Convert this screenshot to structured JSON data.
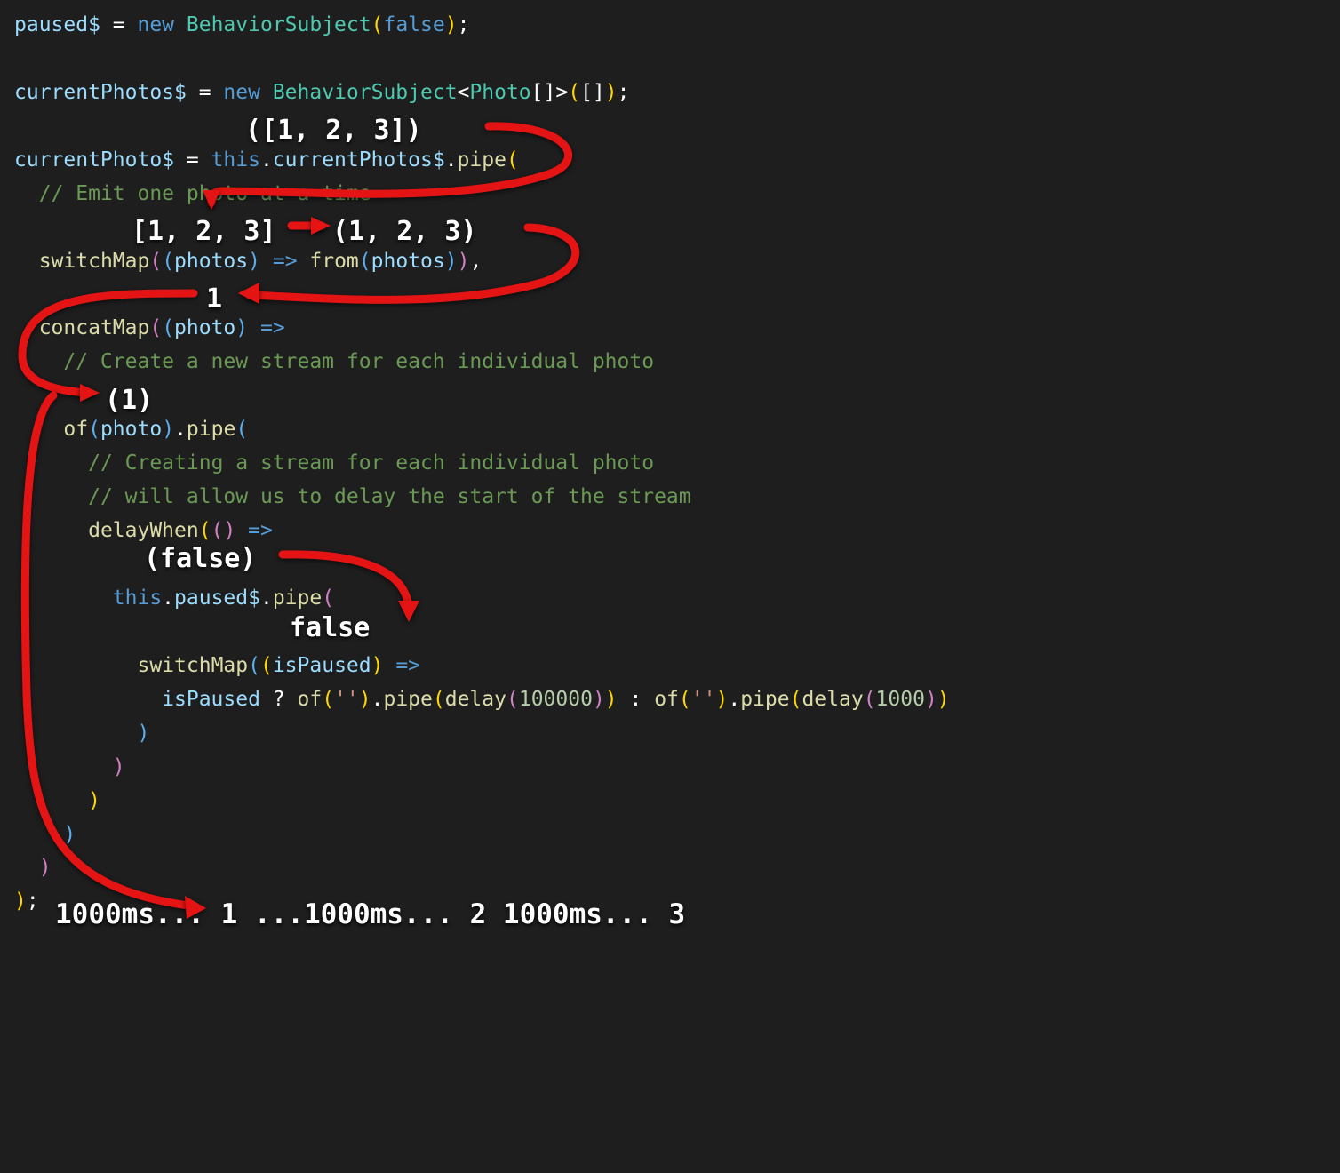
{
  "code": {
    "l1": {
      "var": "paused$",
      "eq": " = ",
      "new": "new",
      "sp": " ",
      "class": "BehaviorSubject",
      "lp": "(",
      "val": "false",
      "rp": ")",
      "semi": ";"
    },
    "l2": {
      "var": "currentPhotos$",
      "eq": " = ",
      "new": "new",
      "sp": " ",
      "class": "BehaviorSubject",
      "lt": "<",
      "type": "Photo",
      "arr": "[]",
      "gt": ">",
      "lp": "(",
      "val": "[]",
      "rp": ")",
      "semi": ";"
    },
    "l3": {
      "var": "currentPhoto$",
      "eq": " = ",
      "this": "this",
      "dot1": ".",
      "prop": "currentPhotos$",
      "dot2": ".",
      "func": "pipe",
      "lp": "("
    },
    "l4": {
      "comment": "// Emit one photo at a time"
    },
    "l5": {
      "func": "switchMap",
      "lp1": "(",
      "lp2": "(",
      "param": "photos",
      "rp2": ")",
      "arrow": " => ",
      "func2": "from",
      "lp3": "(",
      "arg": "photos",
      "rp3": ")",
      "rp1": ")",
      "comma": ","
    },
    "l6": {
      "func": "concatMap",
      "lp1": "(",
      "lp2": "(",
      "param": "photo",
      "rp2": ")",
      "arrow": " =>"
    },
    "l7": {
      "comment": "// Create a new stream for each individual photo"
    },
    "l8": {
      "func": "of",
      "lp1": "(",
      "arg": "photo",
      "rp1": ")",
      "dot": ".",
      "func2": "pipe",
      "lp2": "("
    },
    "l9": {
      "comment": "// Creating a stream for each individual photo"
    },
    "l10": {
      "comment": "// will allow us to delay the start of the stream"
    },
    "l11": {
      "func": "delayWhen",
      "lp1": "(",
      "lp2": "(",
      "rp2": ")",
      "arrow": " =>"
    },
    "l12": {
      "this": "this",
      "dot1": ".",
      "prop": "paused$",
      "dot2": ".",
      "func": "pipe",
      "lp": "("
    },
    "l13": {
      "func": "switchMap",
      "lp1": "(",
      "lp2": "(",
      "param": "isPaused",
      "rp2": ")",
      "arrow": " =>"
    },
    "l14": {
      "cond": "isPaused",
      "q": " ? ",
      "of1": "of",
      "lp1": "(",
      "s1": "''",
      "rp1": ")",
      "dot1": ".",
      "pipe1": "pipe",
      "lp2": "(",
      "delay1": "delay",
      "lp3": "(",
      "n1": "100000",
      "rp3": ")",
      "rp2": ")",
      "colon": " : ",
      "of2": "of",
      "lp4": "(",
      "s2": "''",
      "rp4": ")",
      "dot2": ".",
      "pipe2": "pipe",
      "lp5": "(",
      "delay2": "delay",
      "lp6": "(",
      "n2": "1000",
      "rp6": ")",
      "rp5": ")"
    },
    "close1": ")",
    "close2": ")",
    "close3": ")",
    "close4": ")",
    "close5": ")",
    "last_rp": ")",
    "last_semi": ";"
  },
  "annotations": {
    "a1": "([1, 2, 3])",
    "a2_left": "[1, 2, 3]",
    "a2_right": "(1, 2, 3)",
    "a3": "1",
    "a4": "(1)",
    "a5": "(false)",
    "a6": "false",
    "a7": "1000ms... 1 ...1000ms... 2 1000ms... 3"
  }
}
